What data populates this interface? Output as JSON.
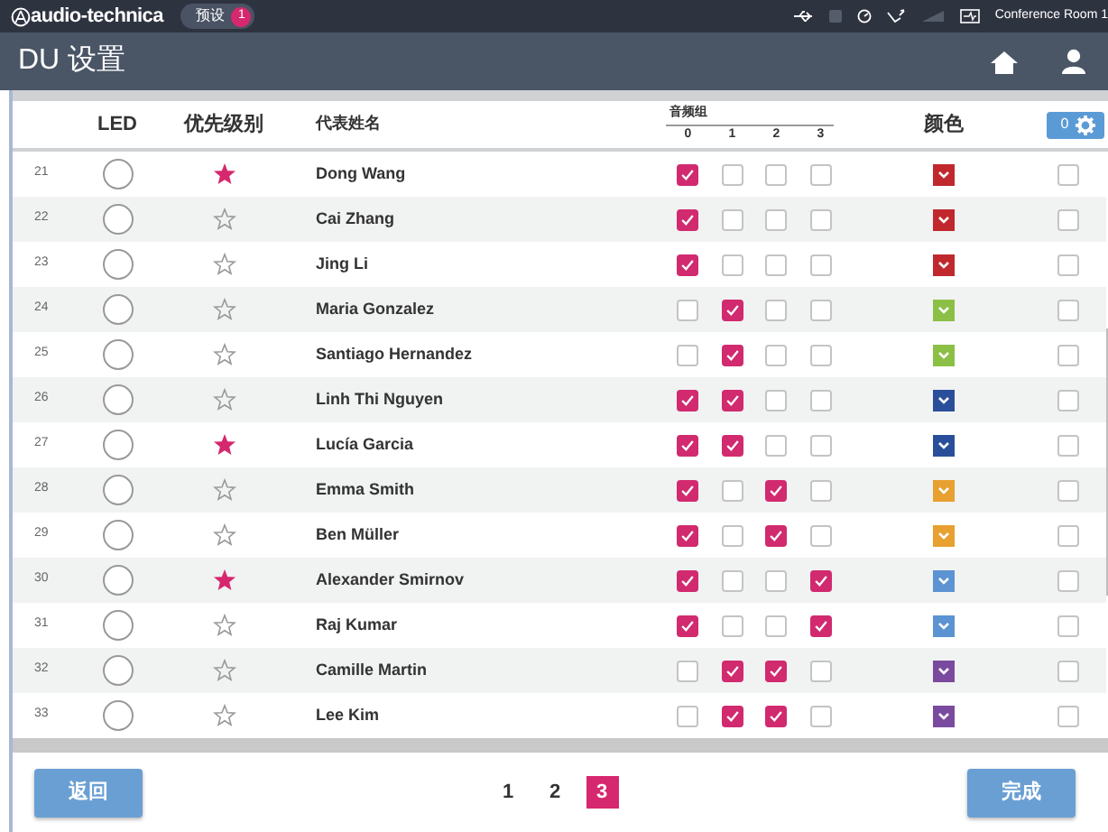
{
  "top_bar": {
    "brand": "audio-technica",
    "preset": {
      "label": "预设",
      "count": "1"
    },
    "room": "Conference Room 1"
  },
  "title_bar": {
    "title": "DU 设置"
  },
  "table": {
    "columns": {
      "led": "LED",
      "priority": "优先级别",
      "name": "代表姓名",
      "group_title": "音频组",
      "groups": [
        "0",
        "1",
        "2",
        "3"
      ],
      "color_label": "颜色",
      "counter": "0"
    },
    "rows": [
      {
        "number": "21",
        "priority": true,
        "name": "Dong Wang",
        "groups": [
          true,
          false,
          false,
          false
        ],
        "color": "#c0282d",
        "checked": false
      },
      {
        "number": "22",
        "priority": false,
        "name": "Cai Zhang",
        "groups": [
          true,
          false,
          false,
          false
        ],
        "color": "#c0282d",
        "checked": false
      },
      {
        "number": "23",
        "priority": false,
        "name": "Jing Li",
        "groups": [
          true,
          false,
          false,
          false
        ],
        "color": "#c0282d",
        "checked": false
      },
      {
        "number": "24",
        "priority": false,
        "name": "Maria Gonzalez",
        "groups": [
          false,
          true,
          false,
          false
        ],
        "color": "#8cbf45",
        "checked": false
      },
      {
        "number": "25",
        "priority": false,
        "name": "Santiago Hernandez",
        "groups": [
          false,
          true,
          false,
          false
        ],
        "color": "#8cbf45",
        "checked": false
      },
      {
        "number": "26",
        "priority": false,
        "name": "Linh Thi Nguyen",
        "groups": [
          true,
          true,
          false,
          false
        ],
        "color": "#2a4f9a",
        "checked": false
      },
      {
        "number": "27",
        "priority": true,
        "name": "Lucía Garcia",
        "groups": [
          true,
          true,
          false,
          false
        ],
        "color": "#2a4f9a",
        "checked": false
      },
      {
        "number": "28",
        "priority": false,
        "name": "Emma Smith",
        "groups": [
          true,
          false,
          true,
          false
        ],
        "color": "#e8a030",
        "checked": false
      },
      {
        "number": "29",
        "priority": false,
        "name": "Ben Müller",
        "groups": [
          true,
          false,
          true,
          false
        ],
        "color": "#e8a030",
        "checked": false
      },
      {
        "number": "30",
        "priority": true,
        "name": "Alexander Smirnov",
        "groups": [
          true,
          false,
          false,
          true
        ],
        "color": "#5b93d3",
        "checked": false
      },
      {
        "number": "31",
        "priority": false,
        "name": "Raj Kumar",
        "groups": [
          true,
          false,
          false,
          true
        ],
        "color": "#5b93d3",
        "checked": false
      },
      {
        "number": "32",
        "priority": false,
        "name": "Camille Martin",
        "groups": [
          false,
          true,
          true,
          false
        ],
        "color": "#7a4a9e",
        "checked": false
      },
      {
        "number": "33",
        "priority": false,
        "name": "Lee Kim",
        "groups": [
          false,
          true,
          true,
          false
        ],
        "color": "#7a4a9e",
        "checked": false
      }
    ]
  },
  "footer": {
    "back": "返回",
    "pages": [
      {
        "label": "1",
        "selected": false
      },
      {
        "label": "2",
        "selected": false
      },
      {
        "label": "3",
        "selected": true
      }
    ],
    "done": "完成"
  }
}
